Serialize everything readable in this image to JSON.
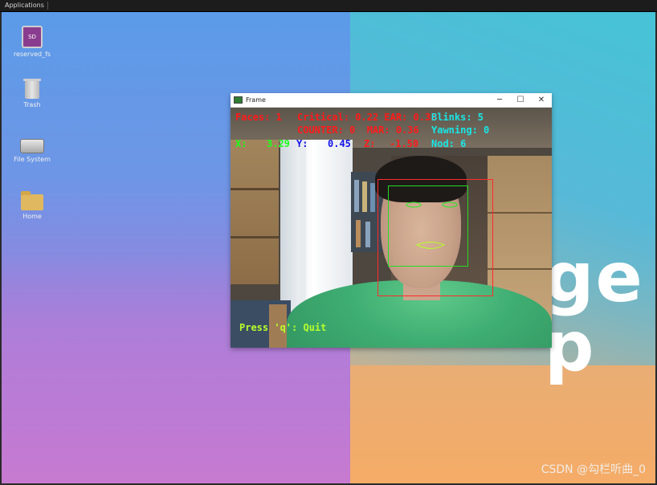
{
  "topbar": {
    "applications_label": "Applications"
  },
  "desktop": {
    "brand_text": "ge p",
    "icons": [
      {
        "label": "reserved_fs",
        "glyph": "SD"
      },
      {
        "label": "Trash"
      },
      {
        "label": "File System"
      },
      {
        "label": "Home"
      }
    ]
  },
  "window": {
    "title": "Frame",
    "buttons": {
      "minimize": "─",
      "maximize": "☐",
      "close": "✕"
    }
  },
  "overlay": {
    "faces": "Faces: 1",
    "critical": "Critical: 0.22 EAR: 0.33",
    "blinks": "Blinks: 5",
    "counter": "COUNTER: 0  MAR: 0.36",
    "yawning": "Yawning: 0",
    "x_label": "X:",
    "x_value": "3.29",
    "y_label": "Y:",
    "y_value": "0.45",
    "z_label": "Z:",
    "z_value": "-1.50",
    "nod": "Nod: 6",
    "quit_hint": "Press 'q': Quit"
  },
  "colors": {
    "red_text": "#ff1a1a",
    "green_text": "#1aff1a",
    "blue_text": "#1414e6",
    "cyan_text": "#19e6e6"
  },
  "watermark": "CSDN @勾栏听曲_0"
}
